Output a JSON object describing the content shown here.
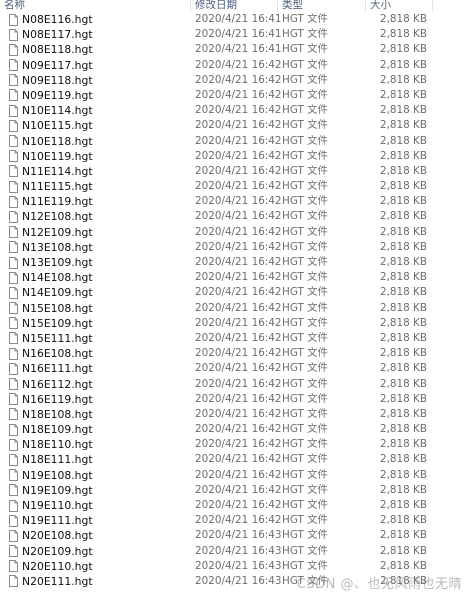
{
  "columns": {
    "name": "名称",
    "modified": "修改日期",
    "type": "类型",
    "size": "大小"
  },
  "file_icon": "file-icon",
  "files": [
    {
      "name": "N08E116.hgt",
      "modified": "2020/4/21 16:41",
      "type": "HGT 文件",
      "size": "2,818 KB"
    },
    {
      "name": "N08E117.hgt",
      "modified": "2020/4/21 16:41",
      "type": "HGT 文件",
      "size": "2,818 KB"
    },
    {
      "name": "N08E118.hgt",
      "modified": "2020/4/21 16:41",
      "type": "HGT 文件",
      "size": "2,818 KB"
    },
    {
      "name": "N09E117.hgt",
      "modified": "2020/4/21 16:42",
      "type": "HGT 文件",
      "size": "2,818 KB"
    },
    {
      "name": "N09E118.hgt",
      "modified": "2020/4/21 16:42",
      "type": "HGT 文件",
      "size": "2,818 KB"
    },
    {
      "name": "N09E119.hgt",
      "modified": "2020/4/21 16:42",
      "type": "HGT 文件",
      "size": "2,818 KB"
    },
    {
      "name": "N10E114.hgt",
      "modified": "2020/4/21 16:42",
      "type": "HGT 文件",
      "size": "2,818 KB"
    },
    {
      "name": "N10E115.hgt",
      "modified": "2020/4/21 16:42",
      "type": "HGT 文件",
      "size": "2,818 KB"
    },
    {
      "name": "N10E118.hgt",
      "modified": "2020/4/21 16:42",
      "type": "HGT 文件",
      "size": "2,818 KB"
    },
    {
      "name": "N10E119.hgt",
      "modified": "2020/4/21 16:42",
      "type": "HGT 文件",
      "size": "2,818 KB"
    },
    {
      "name": "N11E114.hgt",
      "modified": "2020/4/21 16:42",
      "type": "HGT 文件",
      "size": "2,818 KB"
    },
    {
      "name": "N11E115.hgt",
      "modified": "2020/4/21 16:42",
      "type": "HGT 文件",
      "size": "2,818 KB"
    },
    {
      "name": "N11E119.hgt",
      "modified": "2020/4/21 16:42",
      "type": "HGT 文件",
      "size": "2,818 KB"
    },
    {
      "name": "N12E108.hgt",
      "modified": "2020/4/21 16:42",
      "type": "HGT 文件",
      "size": "2,818 KB"
    },
    {
      "name": "N12E109.hgt",
      "modified": "2020/4/21 16:42",
      "type": "HGT 文件",
      "size": "2,818 KB"
    },
    {
      "name": "N13E108.hgt",
      "modified": "2020/4/21 16:42",
      "type": "HGT 文件",
      "size": "2,818 KB"
    },
    {
      "name": "N13E109.hgt",
      "modified": "2020/4/21 16:42",
      "type": "HGT 文件",
      "size": "2,818 KB"
    },
    {
      "name": "N14E108.hgt",
      "modified": "2020/4/21 16:42",
      "type": "HGT 文件",
      "size": "2,818 KB"
    },
    {
      "name": "N14E109.hgt",
      "modified": "2020/4/21 16:42",
      "type": "HGT 文件",
      "size": "2,818 KB"
    },
    {
      "name": "N15E108.hgt",
      "modified": "2020/4/21 16:42",
      "type": "HGT 文件",
      "size": "2,818 KB"
    },
    {
      "name": "N15E109.hgt",
      "modified": "2020/4/21 16:42",
      "type": "HGT 文件",
      "size": "2,818 KB"
    },
    {
      "name": "N15E111.hgt",
      "modified": "2020/4/21 16:42",
      "type": "HGT 文件",
      "size": "2,818 KB"
    },
    {
      "name": "N16E108.hgt",
      "modified": "2020/4/21 16:42",
      "type": "HGT 文件",
      "size": "2,818 KB"
    },
    {
      "name": "N16E111.hgt",
      "modified": "2020/4/21 16:42",
      "type": "HGT 文件",
      "size": "2,818 KB"
    },
    {
      "name": "N16E112.hgt",
      "modified": "2020/4/21 16:42",
      "type": "HGT 文件",
      "size": "2,818 KB"
    },
    {
      "name": "N16E119.hgt",
      "modified": "2020/4/21 16:42",
      "type": "HGT 文件",
      "size": "2,818 KB"
    },
    {
      "name": "N18E108.hgt",
      "modified": "2020/4/21 16:42",
      "type": "HGT 文件",
      "size": "2,818 KB"
    },
    {
      "name": "N18E109.hgt",
      "modified": "2020/4/21 16:42",
      "type": "HGT 文件",
      "size": "2,818 KB"
    },
    {
      "name": "N18E110.hgt",
      "modified": "2020/4/21 16:42",
      "type": "HGT 文件",
      "size": "2,818 KB"
    },
    {
      "name": "N18E111.hgt",
      "modified": "2020/4/21 16:42",
      "type": "HGT 文件",
      "size": "2,818 KB"
    },
    {
      "name": "N19E108.hgt",
      "modified": "2020/4/21 16:42",
      "type": "HGT 文件",
      "size": "2,818 KB"
    },
    {
      "name": "N19E109.hgt",
      "modified": "2020/4/21 16:42",
      "type": "HGT 文件",
      "size": "2,818 KB"
    },
    {
      "name": "N19E110.hgt",
      "modified": "2020/4/21 16:42",
      "type": "HGT 文件",
      "size": "2,818 KB"
    },
    {
      "name": "N19E111.hgt",
      "modified": "2020/4/21 16:42",
      "type": "HGT 文件",
      "size": "2,818 KB"
    },
    {
      "name": "N20E108.hgt",
      "modified": "2020/4/21 16:43",
      "type": "HGT 文件",
      "size": "2,818 KB"
    },
    {
      "name": "N20E109.hgt",
      "modified": "2020/4/21 16:43",
      "type": "HGT 文件",
      "size": "2,818 KB"
    },
    {
      "name": "N20E110.hgt",
      "modified": "2020/4/21 16:43",
      "type": "HGT 文件",
      "size": "2,818 KB"
    },
    {
      "name": "N20E111.hgt",
      "modified": "2020/4/21 16:43",
      "type": "HGT 文件",
      "size": "2,818 KB"
    }
  ],
  "watermark": "CSDN @、也无风雨也无晴"
}
